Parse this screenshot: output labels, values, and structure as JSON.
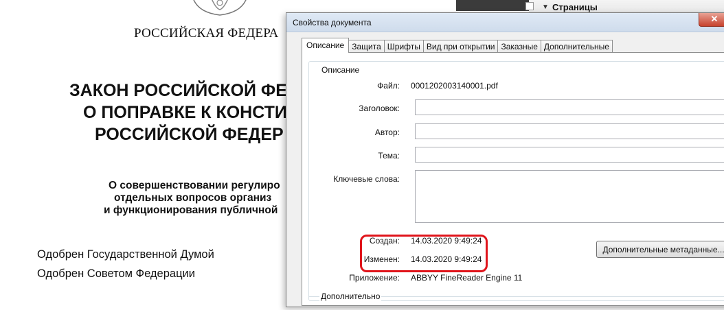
{
  "viewer": {
    "pages_pane_label": "Страницы"
  },
  "pdf": {
    "header": "РОССИЙСКАЯ ФЕДЕРА",
    "title_lines": [
      "ЗАКОН РОССИЙСКОЙ ФЕД",
      "О ПОПРАВКЕ К КОНСТИ",
      "РОССИЙСКОЙ  ФЕДЕР"
    ],
    "subtitle_lines": [
      "О совершенствовании регулиро",
      "отдельных вопросов организ",
      "и функционирования публичной"
    ],
    "approved_lines": [
      "Одобрен Государственной Думой",
      "Одобрен Советом Федерации"
    ]
  },
  "dialog": {
    "title": "Свойства документа",
    "close_label": "✕",
    "tabs": [
      {
        "label": "Описание",
        "active": true
      },
      {
        "label": "Защита",
        "active": false
      },
      {
        "label": "Шрифты",
        "active": false
      },
      {
        "label": "Вид при открытии",
        "active": false
      },
      {
        "label": "Заказные",
        "active": false
      },
      {
        "label": "Дополнительные",
        "active": false
      }
    ],
    "description": {
      "group_label": "Описание",
      "file_label": "Файл:",
      "file_value": "0001202003140001.pdf",
      "title_label": "Заголовок:",
      "title_value": "",
      "author_label": "Автор:",
      "author_value": "",
      "subject_label": "Тема:",
      "subject_value": "",
      "keywords_label": "Ключевые слова:",
      "keywords_value": "",
      "created_label": "Создан:",
      "created_value": "14.03.2020 9:49:24",
      "modified_label": "Изменен:",
      "modified_value": "14.03.2020 9:49:24",
      "app_label": "Приложение:",
      "app_value": "ABBYY FineReader Engine 11",
      "metadata_button": "Дополнительные метаданные..."
    },
    "advanced": {
      "group_label": "Дополнительно"
    }
  },
  "colors": {
    "highlight": "#e0141b",
    "title_bar": "#d6e2f0",
    "close": "#c7432e"
  }
}
